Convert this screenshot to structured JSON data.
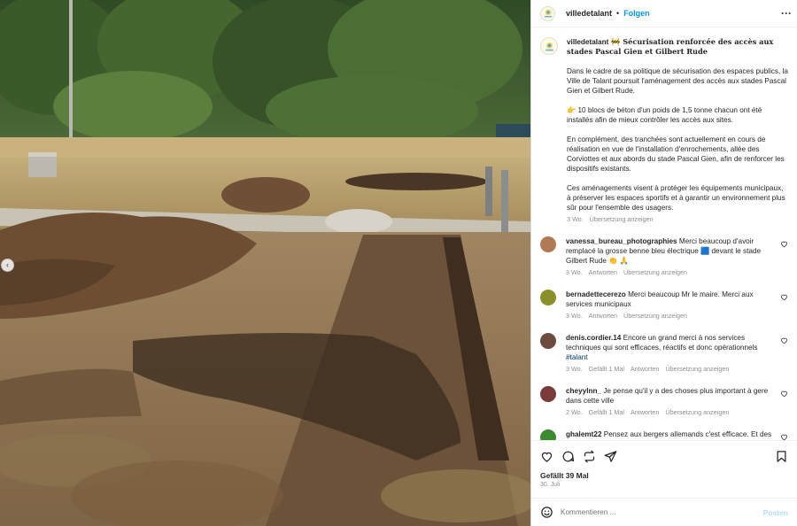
{
  "account": {
    "username": "villedetalant",
    "follow_label": "Folgen",
    "separator": "•"
  },
  "caption": {
    "title": "Sécurisation renforcée des accès aux stades Pascal Gien et Gilbert Rude",
    "paragraphs": [
      "Dans le cadre de sa politique de sécurisation des espaces publics, la Ville de Talant poursuit l'aménagement des accès aux stades Pascal Gien et Gilbert Rude.",
      "👉 10 blocs de béton d'un poids de 1,5 tonne chacun ont été installés afin de mieux contrôler les accès aux sites.",
      "En complément, des tranchées sont actuellement en cours de réalisation en vue de l'installation d'enrochements, allée des Corviottes et aux abords du stade Pascal Gien, afin de renforcer les dispositifs existants.",
      "Ces aménagements visent à protéger les équipements municipaux, à préserver les espaces sportifs et à garantir un environnement plus sûr pour l'ensemble des usagers."
    ],
    "age": "3 Wo.",
    "translate": "Übersetzung anzeigen"
  },
  "comments": [
    {
      "user": "vanessa_bureau_photographies",
      "text": "Merci beaucoup d'avoir remplacé la grosse benne bleu électrique 🟦 devant le stade Gilbert Rude 👏 🙏",
      "age": "3 Wo.",
      "likes": "",
      "reply": "Antworten",
      "translate": "Übersetzung anzeigen",
      "avatar_color": "#b07a55"
    },
    {
      "user": "bernadettecerezo",
      "text": "Merci beaucoup Mr le maire. Merci aux services municipaux",
      "age": "3 Wo.",
      "likes": "",
      "reply": "Antworten",
      "translate": "Übersetzung anzeigen",
      "avatar_color": "#8a8f2a"
    },
    {
      "user": "denis.cordier.14",
      "text": "Encore un grand merci à nos services techniques qui sont efficaces, réactifs et donc opérationnels",
      "hashtag": "#talant",
      "age": "3 Wo.",
      "likes": "Gefällt 1 Mal",
      "reply": "Antworten",
      "translate": "Übersetzung anzeigen",
      "avatar_color": "#6d4c3d"
    },
    {
      "user": "cheyylnn_",
      "text": "Je pense qu'il y a des choses plus important à gere dans cette ville",
      "age": "2 Wo.",
      "likes": "Gefällt 1 Mal",
      "reply": "Antworten",
      "translate": "Übersetzung anzeigen",
      "avatar_color": "#7a3b3b"
    },
    {
      "user": "ghalemt22",
      "text": "Pensez aux bergers allemands c'est efficace. Et des",
      "age": "",
      "likes": "",
      "reply": "",
      "translate": "",
      "avatar_color": "#3c8a2f"
    }
  ],
  "footer": {
    "likes": "Gefällt 39 Mal",
    "date": "30. Juli",
    "comment_placeholder": "Kommentieren ...",
    "post_label": "Posten"
  },
  "colors": {
    "link": "#0095f6",
    "muted": "#8e8e8e",
    "hashtag": "#00376b",
    "post_disabled": "#b2dffc"
  }
}
